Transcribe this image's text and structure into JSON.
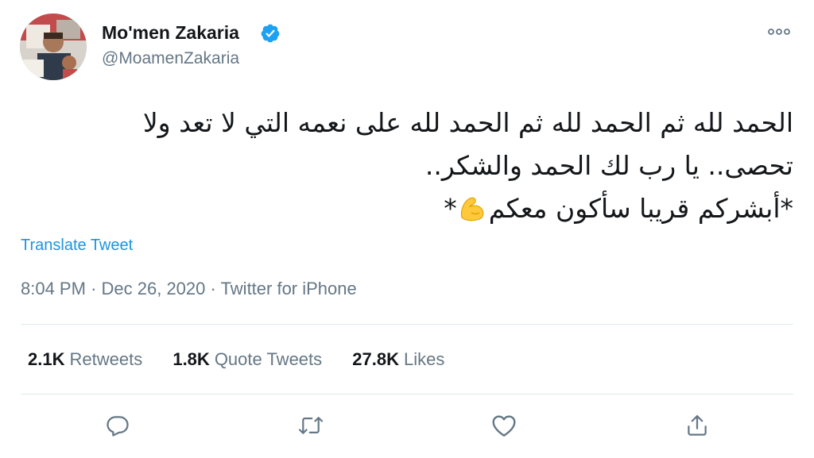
{
  "author": {
    "name": "Mo'men Zakaria",
    "handle": "@MoamenZakaria",
    "verified": true
  },
  "tweet": {
    "lines": [
      "الحمد لله ثم الحمد لله ثم الحمد لله على نعمه التي لا تعد ولا",
      "تحصى.. يا رب لك الحمد والشكر..",
      "*أبشركم قريبا سأكون معكم",
      "*"
    ],
    "emoji": "flexed-biceps"
  },
  "translate_label": "Translate Tweet",
  "meta": {
    "time": "8:04 PM",
    "separator": "·",
    "date": "Dec 26, 2020",
    "source": "Twitter for iPhone"
  },
  "stats": [
    {
      "count": "2.1K",
      "label": "Retweets"
    },
    {
      "count": "1.8K",
      "label": "Quote Tweets"
    },
    {
      "count": "27.8K",
      "label": "Likes"
    }
  ],
  "actions": [
    "reply-icon",
    "retweet-icon",
    "like-icon",
    "share-icon"
  ],
  "colors": {
    "accent": "#1b95e0",
    "verified": "#1da1f2",
    "secondary_text": "#657786",
    "divider": "#e1e8ed",
    "emoji": "#ffc83d"
  }
}
